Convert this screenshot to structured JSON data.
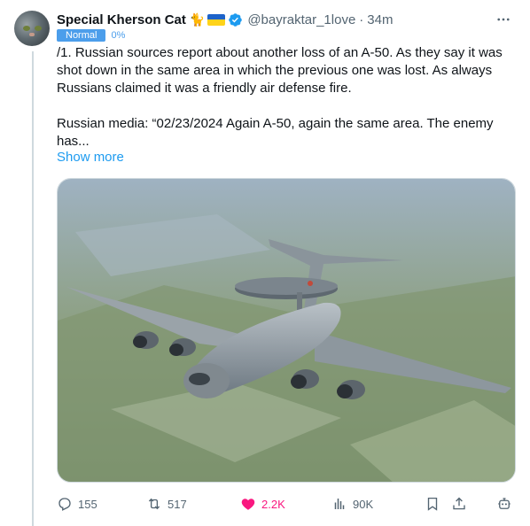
{
  "author": {
    "name": "Special Kherson Cat",
    "emoji": "🐈",
    "handle": "@bayraktar_1love",
    "separator": "·",
    "time": "34m"
  },
  "badge": {
    "label": "Normal",
    "percent": "0%"
  },
  "tweet": {
    "paragraph1": "/1. Russian sources report about another loss of an A-50. As they say it was shot down in the same area in which the previous one was lost. As always Russians claimed it was a friendly air defense fire.",
    "paragraph2": "Russian media: “02/23/2024 Again A-50, again the same area. The enemy has...",
    "show_more": "Show more"
  },
  "media": {
    "icon": "a-50-aircraft-photo"
  },
  "actions": {
    "replies": "155",
    "reposts": "517",
    "likes": "2.2K",
    "views": "90K"
  },
  "colors": {
    "accent": "#1d9bf0",
    "like": "#f91880",
    "muted": "#536471",
    "badge": "#4c9eeb"
  }
}
